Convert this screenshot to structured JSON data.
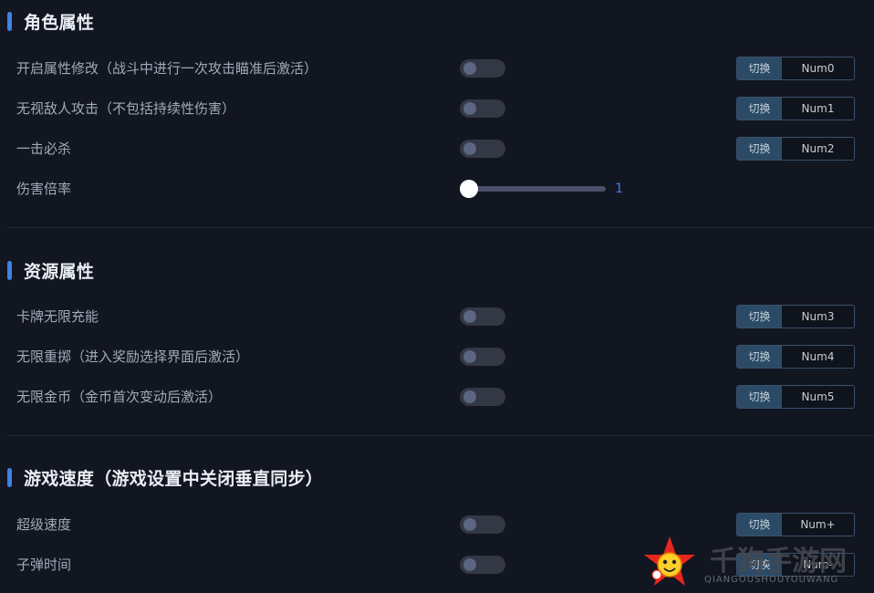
{
  "sections": [
    {
      "title": "角色属性",
      "rows": [
        {
          "label": "开启属性修改（战斗中进行一次攻击瞄准后激活）",
          "switch_label": "切换",
          "key": "Num0",
          "enabled": false
        },
        {
          "label": "无视敌人攻击（不包括持续性伤害）",
          "switch_label": "切换",
          "key": "Num1",
          "enabled": false
        },
        {
          "label": "一击必杀",
          "switch_label": "切换",
          "key": "Num2",
          "enabled": false
        }
      ],
      "slider": {
        "label": "伤害倍率",
        "value": "1",
        "fraction": 0.0
      }
    },
    {
      "title": "资源属性",
      "rows": [
        {
          "label": "卡牌无限充能",
          "switch_label": "切换",
          "key": "Num3",
          "enabled": false
        },
        {
          "label": "无限重掷（进入奖励选择界面后激活）",
          "switch_label": "切换",
          "key": "Num4",
          "enabled": false
        },
        {
          "label": "无限金币（金币首次变动后激活）",
          "switch_label": "切换",
          "key": "Num5",
          "enabled": false
        }
      ]
    },
    {
      "title": "游戏速度（游戏设置中关闭垂直同步）",
      "rows": [
        {
          "label": "超级速度",
          "switch_label": "切换",
          "key": "Num+",
          "enabled": false
        },
        {
          "label": "子弹时间",
          "switch_label": "切换",
          "key": "Num-",
          "enabled": false
        }
      ]
    }
  ],
  "watermark": {
    "text": "千狗手游网",
    "subtext": "QIANGOUSHOUYOUWANG"
  },
  "colors": {
    "background": "#121620",
    "accent": "#3f82e6",
    "toggle_off": "#343845",
    "hotkey_switch_bg": "#2b4a66"
  }
}
